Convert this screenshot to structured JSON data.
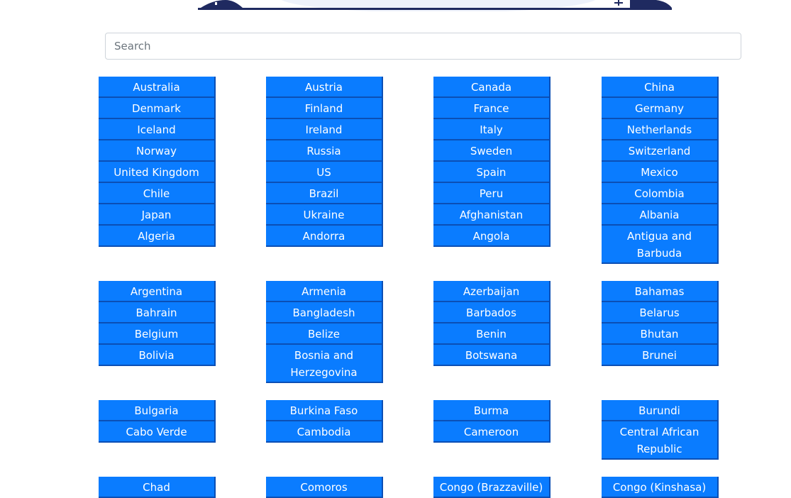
{
  "colors": {
    "button_bg": "#0a7cff",
    "button_border": "#0b4fb5",
    "header_art": "#1f2a60"
  },
  "search": {
    "placeholder": "Search",
    "value": ""
  },
  "country_groups": [
    [
      [
        "Australia",
        "Austria",
        "Canada",
        "China"
      ],
      [
        "Denmark",
        "Finland",
        "France",
        "Germany"
      ],
      [
        "Iceland",
        "Ireland",
        "Italy",
        "Netherlands"
      ],
      [
        "Norway",
        "Russia",
        "Sweden",
        "Switzerland"
      ],
      [
        "United Kingdom",
        "US",
        "Spain",
        "Mexico"
      ],
      [
        "Chile",
        "Brazil",
        "Peru",
        "Colombia"
      ],
      [
        "Japan",
        "Ukraine",
        "Afghanistan",
        "Albania"
      ],
      [
        "Algeria",
        "Andorra",
        "Angola",
        "Antigua and Barbuda"
      ]
    ],
    [
      [
        "Argentina",
        "Armenia",
        "Azerbaijan",
        "Bahamas"
      ],
      [
        "Bahrain",
        "Bangladesh",
        "Barbados",
        "Belarus"
      ],
      [
        "Belgium",
        "Belize",
        "Benin",
        "Bhutan"
      ],
      [
        "Bolivia",
        "Bosnia and Herzegovina",
        "Botswana",
        "Brunei"
      ]
    ],
    [
      [
        "Bulgaria",
        "Burkina Faso",
        "Burma",
        "Burundi"
      ],
      [
        "Cabo Verde",
        "Cambodia",
        "Cameroon",
        "Central African Republic"
      ]
    ],
    [
      [
        "Chad",
        "Comoros",
        "Congo (Brazzaville)",
        "Congo (Kinshasa)"
      ]
    ]
  ]
}
